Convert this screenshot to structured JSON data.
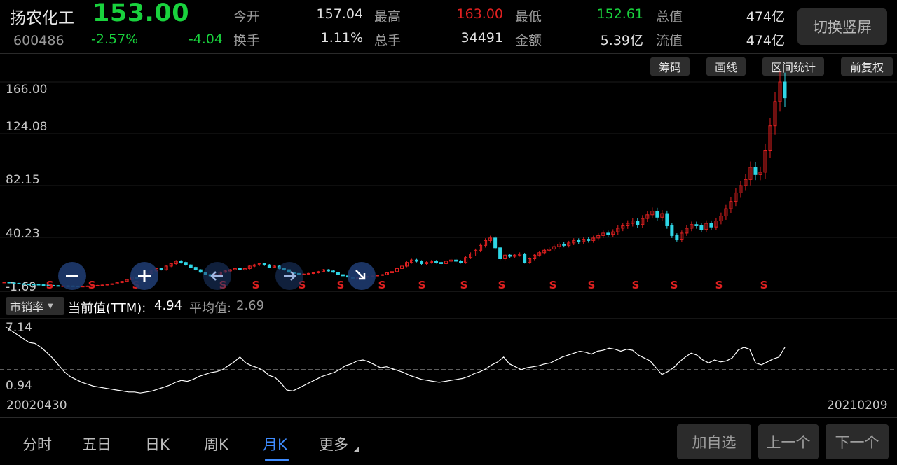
{
  "quote": {
    "name": "扬农化工",
    "code": "600486",
    "price": "153.00",
    "change_pct": "-2.57%",
    "change": "-4.04",
    "open_label": "今开",
    "open": "157.04",
    "high_label": "最高",
    "high": "163.00",
    "low_label": "最低",
    "low": "152.61",
    "mktcap_label": "总值",
    "mktcap": "474亿",
    "turnover_label": "换手",
    "turnover": "1.11%",
    "volume_label": "总手",
    "volume": "34491",
    "amount_label": "金额",
    "amount": "5.39亿",
    "float_label": "流值",
    "float_cap": "474亿",
    "switch_label": "切换竖屏"
  },
  "tools": [
    "筹码",
    "画线",
    "区间统计",
    "前复权"
  ],
  "indicator": {
    "name": "市销率",
    "current_label": "当前值(TTM):",
    "current": "4.94",
    "avg_label": "平均值:",
    "avg": "2.69"
  },
  "dates": {
    "start": "20020430",
    "end": "20210209"
  },
  "tabs": [
    "分时",
    "五日",
    "日K",
    "周K",
    "月K",
    "更多"
  ],
  "active_tab": "月K",
  "buttons": {
    "add": "加自选",
    "prev": "上一个",
    "next": "下一个"
  },
  "zoom_controls": [
    "zoom-out",
    "zoom-in",
    "pan-left",
    "pan-right",
    "jump-latest"
  ],
  "colors": {
    "up": "#e02020",
    "down": "#19d23d",
    "accent": "#3f8cff",
    "cyan": "#2fd6e6"
  },
  "chart_data": [
    {
      "type": "candlestick",
      "y_axis_labels": [
        "166.00",
        "124.08",
        "82.15",
        "40.23",
        "-1.69"
      ],
      "ylim": [
        -1.69,
        166.0
      ],
      "x_range": [
        "20020430",
        "20210209"
      ],
      "markers": [
        "S",
        "S",
        "S",
        "S",
        "S",
        "S",
        "S",
        "S",
        "S",
        "S",
        "S",
        "S",
        "S",
        "S",
        "S",
        "S",
        "S"
      ],
      "close": [
        1.8,
        1.2,
        0.9,
        0.5,
        0.2,
        0.1,
        0.0,
        -0.3,
        -0.5,
        -0.8,
        -1.0,
        -1.2,
        -1.2,
        -1.3,
        -1.4,
        -1.5,
        -1.5,
        -1.3,
        -1.0,
        -0.8,
        -0.5,
        0.0,
        0.5,
        1.5,
        2.5,
        4.0,
        6.0,
        5.0,
        7.0,
        9.0,
        11.0,
        13.0,
        12.0,
        15.0,
        17.0,
        19.0,
        18.0,
        16.0,
        14.0,
        12.0,
        10.0,
        8.0,
        7.0,
        8.0,
        10.0,
        11.0,
        12.0,
        13.0,
        12.0,
        13.0,
        15.0,
        16.0,
        17.0,
        16.0,
        14.0,
        15.0,
        13.0,
        12.0,
        10.0,
        9.0,
        8.0,
        8.5,
        9.0,
        9.5,
        10.5,
        12.0,
        11.0,
        10.0,
        8.0,
        7.0,
        6.0,
        5.0,
        5.5,
        6.0,
        6.5,
        7.0,
        7.5,
        8.0,
        9.5,
        10.5,
        13.0,
        15.0,
        18.0,
        20.0,
        19.0,
        17.0,
        18.0,
        19.0,
        18.0,
        17.0,
        19.0,
        20.0,
        19.0,
        18.0,
        22.0,
        25.0,
        28.0,
        32.0,
        36.0,
        38.0,
        30.0,
        21.0,
        24.0,
        23.0,
        24.0,
        25.0,
        18.0,
        21.0,
        24.0,
        26.0,
        28.0,
        29.0,
        31.0,
        33.0,
        32.0,
        34.0,
        36.0,
        35.0,
        37.0,
        36.0,
        38.0,
        40.0,
        42.0,
        41.0,
        43.0,
        46.0,
        48.0,
        50.0,
        52.0,
        49.0,
        54.0,
        57.0,
        60.0,
        55.0,
        58.0,
        48.0,
        40.0,
        37.0,
        42.0,
        46.0,
        49.0,
        48.0,
        45.0,
        50.0,
        47.0,
        52.0,
        56.0,
        62.0,
        68.0,
        75.0,
        81.0,
        86.0,
        96.0,
        90.0,
        92.0,
        110.0,
        130.0,
        150.0,
        166.0,
        153.0
      ]
    },
    {
      "type": "line",
      "series_name": "市销率",
      "y_axis_labels": [
        "7.14",
        "0.94"
      ],
      "ylim": [
        0.94,
        7.14
      ],
      "average": 2.69,
      "current": 4.94,
      "values": [
        7.0,
        6.6,
        6.2,
        5.8,
        5.4,
        5.3,
        4.9,
        4.4,
        3.8,
        3.1,
        2.4,
        1.9,
        1.6,
        1.3,
        1.1,
        0.9,
        0.8,
        0.7,
        0.6,
        0.5,
        0.4,
        0.3,
        0.3,
        0.2,
        0.3,
        0.4,
        0.6,
        0.8,
        1.0,
        1.3,
        1.5,
        1.4,
        1.6,
        1.9,
        2.1,
        2.3,
        2.4,
        2.6,
        3.0,
        3.4,
        3.9,
        3.3,
        3.0,
        2.8,
        2.5,
        2.0,
        1.8,
        1.2,
        0.5,
        0.4,
        0.7,
        1.0,
        1.3,
        1.6,
        1.9,
        2.1,
        2.3,
        2.6,
        3.0,
        3.2,
        3.5,
        3.6,
        3.4,
        3.1,
        2.8,
        2.9,
        2.7,
        2.5,
        2.3,
        2.0,
        1.8,
        1.6,
        1.5,
        1.4,
        1.3,
        1.4,
        1.5,
        1.6,
        1.7,
        1.9,
        2.2,
        2.4,
        2.7,
        3.1,
        3.4,
        3.9,
        3.2,
        2.9,
        2.6,
        2.8,
        2.9,
        3.0,
        3.2,
        3.3,
        3.6,
        3.9,
        4.1,
        4.3,
        4.5,
        4.4,
        4.2,
        4.5,
        4.6,
        4.8,
        4.7,
        4.5,
        4.7,
        4.6,
        4.1,
        3.8,
        3.5,
        2.8,
        2.1,
        2.4,
        2.8,
        3.4,
        3.9,
        4.3,
        4.1,
        3.6,
        3.3,
        3.6,
        3.4,
        3.5,
        3.8,
        4.6,
        4.9,
        4.7,
        3.3,
        3.1,
        3.4,
        3.7,
        3.9,
        4.9
      ]
    }
  ]
}
